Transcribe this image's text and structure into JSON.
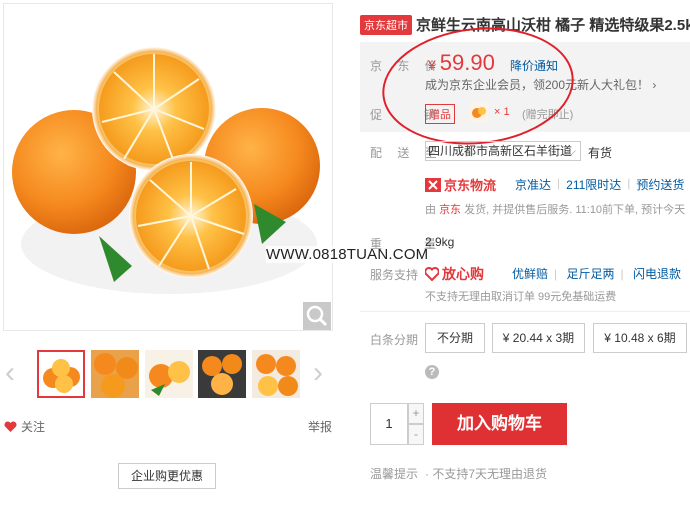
{
  "gallery": {
    "follow_label": "关注",
    "report_label": "举报",
    "corporate_button": "企业购更优惠"
  },
  "watermark": "WWW.0818TUAN.COM",
  "product": {
    "store_badge": "京东超市",
    "title": "京鲜生云南高山沃柑 橘子 精选特级果2.5k"
  },
  "price_section": {
    "label": "京 东 价",
    "currency": "¥",
    "price": "59.90",
    "notify_link": "降价通知",
    "member_text": "成为京东企业会员，领200元新人大礼包！ ›",
    "promo_label": "促　　销",
    "gift_tag": "赠品",
    "gift_qty": "× 1",
    "gift_note": "(赠完即止)"
  },
  "delivery": {
    "label": "配 送 至",
    "address": "四川成都市高新区石羊街道",
    "stock": "有货",
    "logistics_brand": "京东物流",
    "services": [
      "京准达",
      "211限时达",
      "预约送货"
    ],
    "ship_prefix": "由 ",
    "ship_seller": "京东",
    "ship_suffix": " 发货, 并提供售后服务. 11:10前下单, 预计今天"
  },
  "weight": {
    "label": "重　　量",
    "value": "2.9kg"
  },
  "service": {
    "label": "服务支持",
    "brand": "放心购",
    "items": [
      "优鲜赔",
      "足斤足两",
      "闪电退款"
    ],
    "note": "不支持无理由取消订单  99元免基础运费"
  },
  "installment": {
    "label": "白条分期",
    "options": [
      "不分期",
      "¥ 20.44 x 3期",
      "¥ 10.48 x 6期"
    ]
  },
  "cart": {
    "quantity": "1",
    "plus": "+",
    "minus": "-",
    "add_label": "加入购物车"
  },
  "tips": {
    "label": "温馨提示",
    "text": "· 不支持7天无理由退货"
  },
  "colors": {
    "accent": "#e4393c",
    "link": "#005aa0"
  },
  "icons": [
    "heart-icon",
    "magnifier-icon",
    "chevron-left-icon",
    "chevron-right-icon",
    "truck-icon",
    "shield-heart-icon",
    "question-icon"
  ]
}
